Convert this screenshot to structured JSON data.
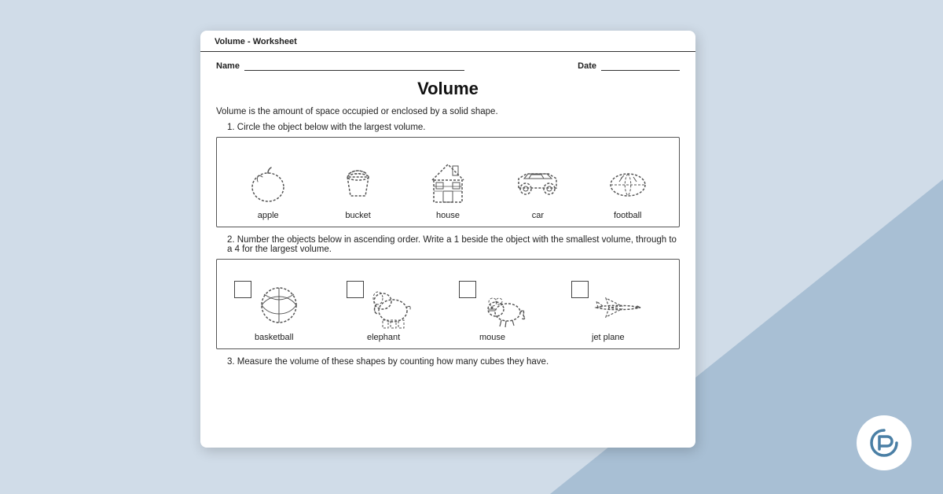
{
  "background": {
    "color": "#d0dce8",
    "triangle_color": "#a8bfd4"
  },
  "logo": {
    "symbol": "t"
  },
  "worksheet": {
    "header_title": "Volume - Worksheet",
    "name_label": "Name",
    "date_label": "Date",
    "title": "Volume",
    "definition": "Volume is the amount of space occupied or enclosed by a solid shape.",
    "question1": {
      "number": "1.",
      "text": "Circle the object below with the largest volume.",
      "objects": [
        {
          "label": "apple",
          "type": "apple"
        },
        {
          "label": "bucket",
          "type": "bucket"
        },
        {
          "label": "house",
          "type": "house"
        },
        {
          "label": "car",
          "type": "car"
        },
        {
          "label": "football",
          "type": "football"
        }
      ]
    },
    "question2": {
      "number": "2.",
      "text": "Number the objects below in ascending order. Write a 1 beside the object with the smallest volume, through to a 4 for the largest volume.",
      "objects": [
        {
          "label": "basketball",
          "type": "basketball"
        },
        {
          "label": "elephant",
          "type": "elephant"
        },
        {
          "label": "mouse",
          "type": "mouse"
        },
        {
          "label": "jet plane",
          "type": "jetplane"
        }
      ]
    },
    "question3": {
      "number": "3.",
      "text": "Measure the volume of these shapes by counting how many cubes they have."
    }
  }
}
